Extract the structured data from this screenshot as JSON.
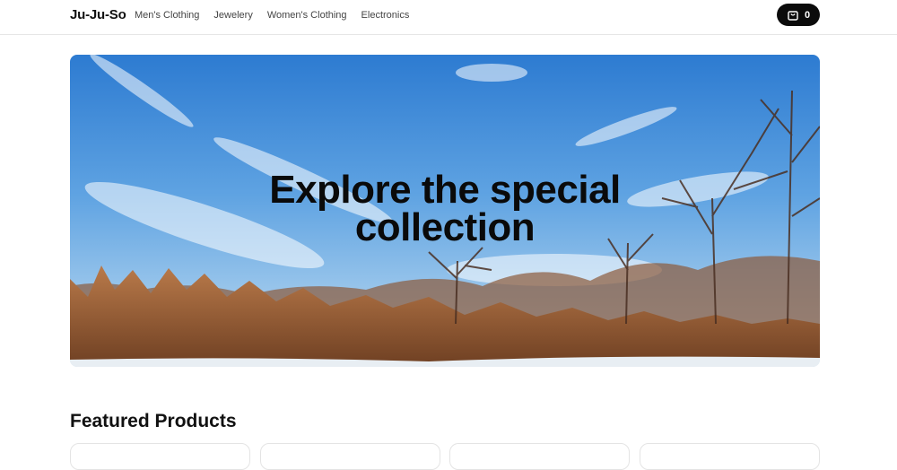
{
  "header": {
    "brand": "Ju-Ju-So",
    "nav": [
      {
        "label": "Men's Clothing"
      },
      {
        "label": "Jewelery"
      },
      {
        "label": "Women's Clothing"
      },
      {
        "label": "Electronics"
      }
    ],
    "cart": {
      "icon": "shopping-bag-icon",
      "count": "0"
    }
  },
  "hero": {
    "title_line1": "Explore the special",
    "title_line2": "collection"
  },
  "featured": {
    "title": "Featured Products"
  },
  "colors": {
    "sky_top": "#2f7fd4",
    "sky_bottom": "#bcdcf2",
    "grass": "#a0643a",
    "accent": "#0b0b0b"
  }
}
